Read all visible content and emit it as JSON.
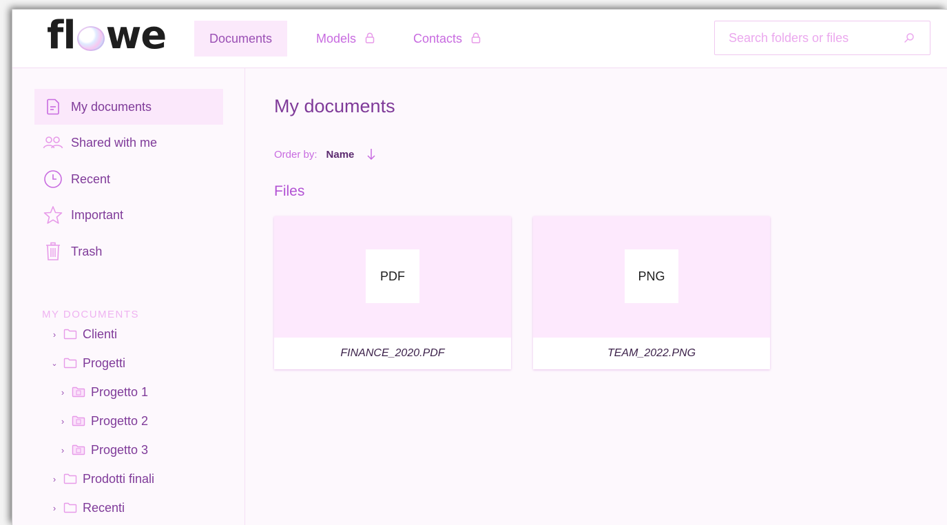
{
  "app": {
    "logo_text_left": "fl",
    "logo_text_right": "we",
    "logo_name": "flowe"
  },
  "nav": {
    "tabs": [
      {
        "label": "Documents",
        "active": true,
        "locked": false
      },
      {
        "label": "Models",
        "active": false,
        "locked": true
      },
      {
        "label": "Contacts",
        "active": false,
        "locked": true
      }
    ]
  },
  "search": {
    "placeholder": "Search folders or files",
    "value": ""
  },
  "sidebar": {
    "items": [
      {
        "label": "My documents",
        "icon": "document-icon",
        "active": true
      },
      {
        "label": "Shared with me",
        "icon": "users-icon",
        "active": false
      },
      {
        "label": "Recent",
        "icon": "clock-icon",
        "active": false
      },
      {
        "label": "Important",
        "icon": "star-icon",
        "active": false
      },
      {
        "label": "Trash",
        "icon": "trash-icon",
        "active": false
      }
    ],
    "section_label": "MY DOCUMENTS",
    "tree": [
      {
        "label": "Clienti",
        "expanded": false,
        "level": 0
      },
      {
        "label": "Progetti",
        "expanded": true,
        "level": 0
      },
      {
        "label": "Progetto 1",
        "expanded": false,
        "level": 1
      },
      {
        "label": "Progetto 2",
        "expanded": false,
        "level": 1
      },
      {
        "label": "Progetto 3",
        "expanded": false,
        "level": 1
      },
      {
        "label": "Prodotti finali",
        "expanded": false,
        "level": 0
      },
      {
        "label": "Recenti",
        "expanded": false,
        "level": 0
      }
    ]
  },
  "main": {
    "title": "My documents",
    "order_label": "Order by:",
    "order_value": "Name",
    "files_heading": "Files",
    "files": [
      {
        "type": "PDF",
        "name": "FINANCE_2020.PDF"
      },
      {
        "type": "PNG",
        "name": "TEAM_2022.PNG"
      }
    ]
  },
  "colors": {
    "accent": "#c86be0",
    "text_primary": "#7f3a99",
    "active_bg": "#fbe8fb",
    "card_bg": "#fde9fd",
    "page_bg": "#fdf8fd"
  }
}
